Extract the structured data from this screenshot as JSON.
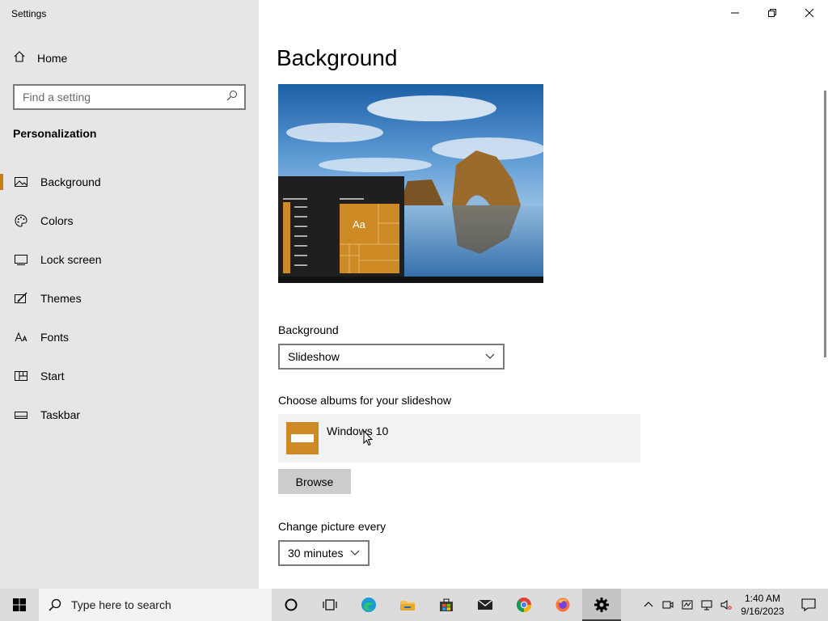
{
  "window": {
    "title": "Settings"
  },
  "sidebar": {
    "home_label": "Home",
    "search_placeholder": "Find a setting",
    "section_title": "Personalization",
    "items": [
      {
        "label": "Background",
        "icon": "picture-icon",
        "active": true
      },
      {
        "label": "Colors",
        "icon": "palette-icon",
        "active": false
      },
      {
        "label": "Lock screen",
        "icon": "lock-screen-icon",
        "active": false
      },
      {
        "label": "Themes",
        "icon": "brush-icon",
        "active": false
      },
      {
        "label": "Fonts",
        "icon": "font-icon",
        "active": false
      },
      {
        "label": "Start",
        "icon": "start-tiles-icon",
        "active": false
      },
      {
        "label": "Taskbar",
        "icon": "taskbar-icon",
        "active": false
      }
    ]
  },
  "main": {
    "title": "Background",
    "preview": {
      "tile_label": "Aa"
    },
    "background_label": "Background",
    "background_value": "Slideshow",
    "albums_label": "Choose albums for your slideshow",
    "album_name": "Windows 10",
    "browse_label": "Browse",
    "change_label": "Change picture every",
    "change_value": "30 minutes"
  },
  "taskbar": {
    "search_placeholder": "Type here to search",
    "apps": [
      "start-icon",
      "cortana-icon",
      "task-view-icon",
      "edge-icon",
      "file-explorer-icon",
      "store-icon",
      "mail-icon",
      "chrome-icon",
      "firefox-icon",
      "settings-icon"
    ],
    "time": "1:40 AM",
    "date": "9/16/2023"
  },
  "colors": {
    "accent": "#c97e1c",
    "sidebar_bg": "#e6e6e6",
    "tile": "#cd8a25"
  }
}
